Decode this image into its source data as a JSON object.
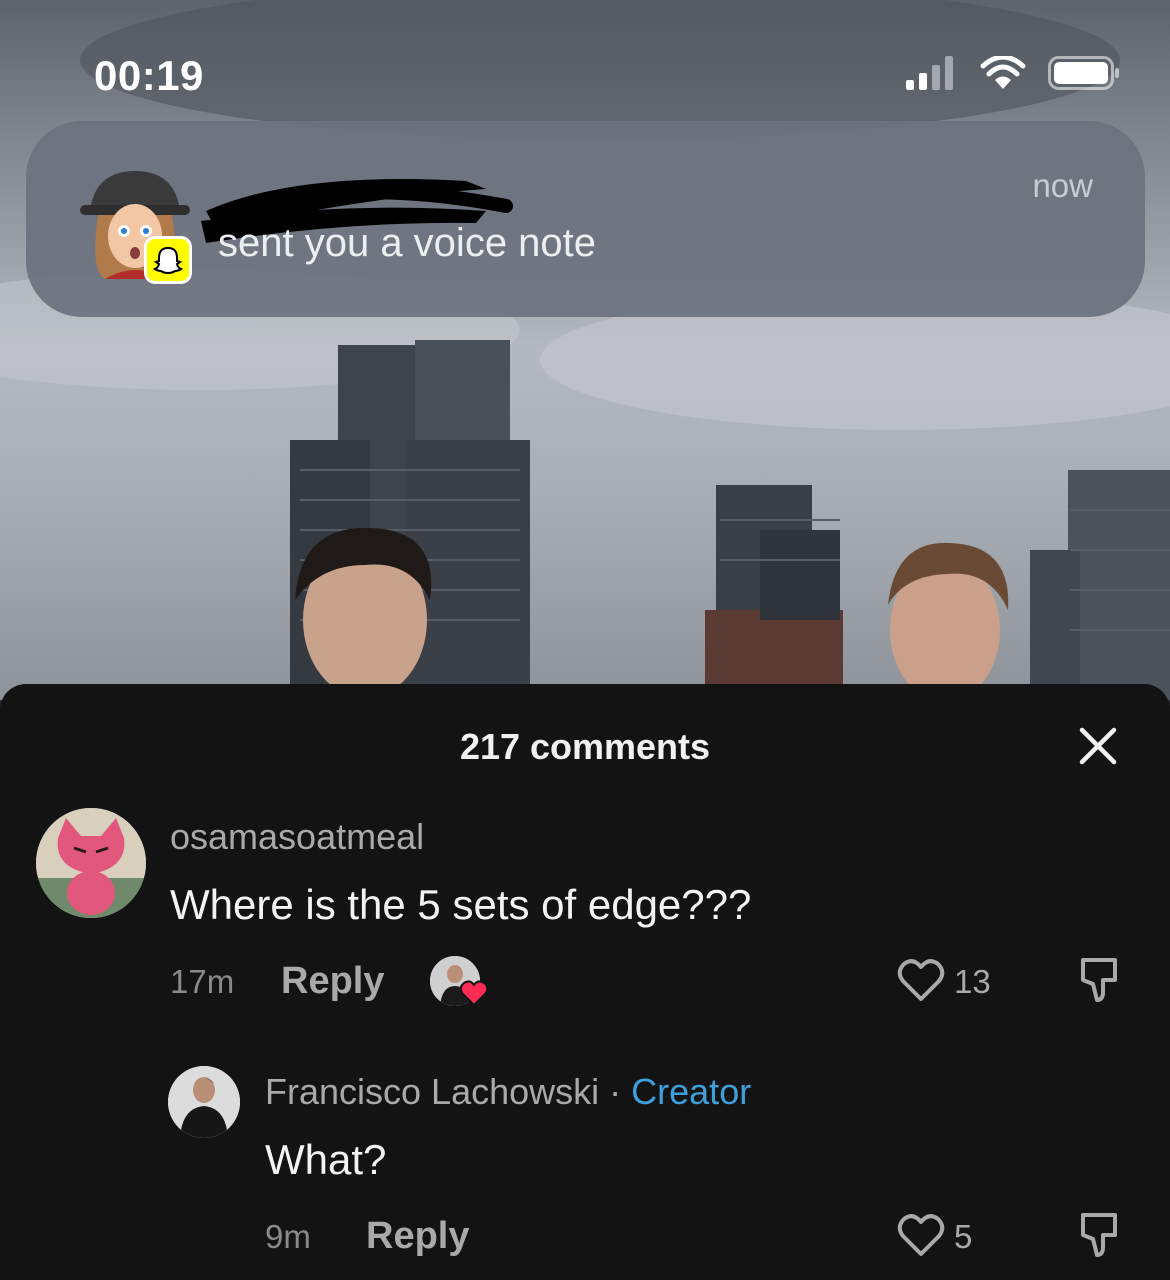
{
  "status_bar": {
    "time": "00:19",
    "signal_bars": 2,
    "battery_level": 0.95
  },
  "notification": {
    "app": "Snapchat",
    "sender_redacted": true,
    "message": "sent you a voice note",
    "time": "now",
    "badge_color": "#fffc00"
  },
  "comments_sheet": {
    "title": "217 comments",
    "comments": [
      {
        "username": "osamasoatmeal",
        "text": "Where is the 5 sets of edge???",
        "time": "17m",
        "reply_label": "Reply",
        "likes": "13",
        "liked_by_creator": true,
        "replies": [
          {
            "username": "Francisco Lachowski",
            "separator": "·",
            "badge": "Creator",
            "text": "What?",
            "time": "9m",
            "reply_label": "Reply",
            "likes": "5"
          }
        ]
      }
    ]
  },
  "colors": {
    "sheet_bg": "#131313",
    "creator_badge": "#3d9fdc",
    "like_heart": "#fe2c55"
  }
}
